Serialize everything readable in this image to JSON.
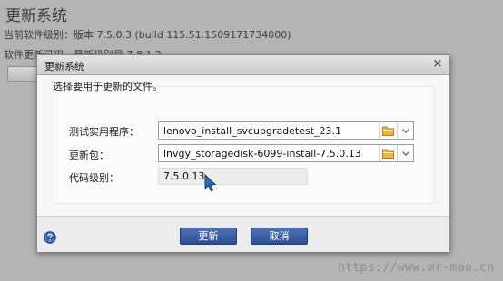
{
  "background": {
    "title": "更新系统",
    "current_level": "当前软件级别：版本 7.5.0.3 (build 115.51.1509171734000)",
    "update_available": "软件更新可用。最新级别是 7.8.1.2。"
  },
  "watermark": "https://www.mr-mao.cn",
  "dialog": {
    "title": "更新系统",
    "close_glyph": "×",
    "instruction": "选择要用于更新的文件。",
    "test_utility": {
      "label": "测试实用程序：",
      "value": "lenovo_install_svcupgradetest_23.1"
    },
    "update_package": {
      "label": "更新包：",
      "value": "lnvgy_storagedisk-6099-install-7.5.0.13"
    },
    "code_level": {
      "label": "代码级别：",
      "value": "7.5.0.13"
    },
    "buttons": {
      "update": "更新",
      "cancel": "取消"
    }
  },
  "icons": {
    "folder": "folder-icon",
    "dropdown": "chevron-down-icon",
    "help": "help-icon",
    "close": "close-icon",
    "cursor": "mouse-pointer-icon"
  },
  "colors": {
    "primary_button": "#2f5597",
    "folder": "#e6a23a",
    "help": "#2d5aa8"
  }
}
